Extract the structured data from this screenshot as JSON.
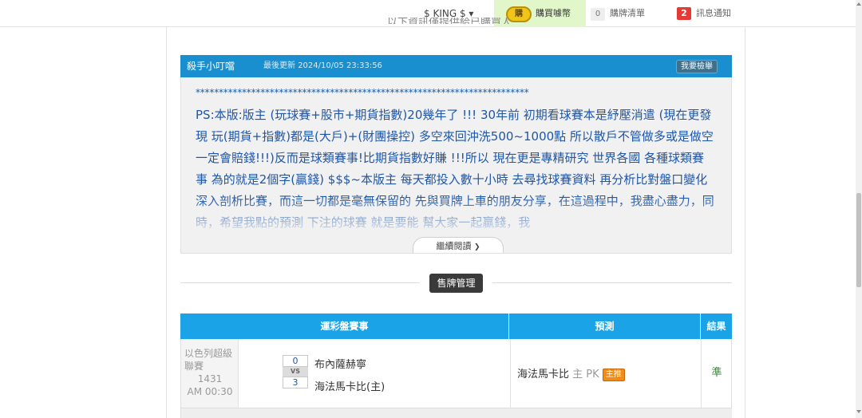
{
  "topbar": {
    "user_label": "$ KING $ ▾",
    "coin_label": "購",
    "buy_coins_label": "購買噱幣",
    "cart_count": "0",
    "cart_label": "購牌清單",
    "message_count": "2",
    "message_label": "訊息通知"
  },
  "notice_partial": "以下資訊僅提供給已購買人",
  "article": {
    "author": "殺手小叮噹",
    "updated_label": "最後更新",
    "updated_time": "2024/10/05 23:33:56",
    "report_label": "我要檢舉",
    "stars": "************************************************************************",
    "body": "PS:本版:版主 (玩球賽+股市+期貨指數)20幾年了 !!! 30年前 初期看球賽本是紓壓消遣 (現在更發現 玩(期貨+指數)都是(大戶)+(財團操控) 多空來回沖洗500~1000點 所以散戶不管做多或是做空 一定會賠錢!!!)反而是球類賽事!比期貨指數好賺 !!!所以 現在更是專精研究 世界各國 各種球類賽事 為的就是2個字(贏錢) $$$~本版主 每天都投入數十小時 去尋找球賽資料 再分析比對盤口變化 深入剖析比賽，而這一切都是毫無保留的 先與買牌上車的朋友分享，在這過程中，我盡心盡力，同時，希望我點的預測 下注的球賽 就是要能 幫大家一起贏錢，我",
    "read_more_label": "繼續閱讀"
  },
  "sale_management_label": "售牌管理",
  "table": {
    "headers": {
      "event": "運彩盤賽事",
      "prediction": "預測",
      "result": "結果"
    },
    "rows": [
      {
        "league": "以色列超級聯賽",
        "game_no": "1431",
        "time": "AM 00:30",
        "away_score": "0",
        "vs": "VS",
        "home_score": "3",
        "away_team": "布內薩赫寧",
        "home_team": "海法馬卡比(主)",
        "prediction_team": "海法馬卡比",
        "prediction_side": "主 PK",
        "prediction_tag": "主推",
        "result": "準"
      }
    ]
  },
  "colors": {
    "header_blue": "#1a8fcf",
    "table_header_blue": "#1aa3e6",
    "article_text": "#1f56a8",
    "win_green": "#2e8b2e",
    "alert_red": "#e53935"
  }
}
